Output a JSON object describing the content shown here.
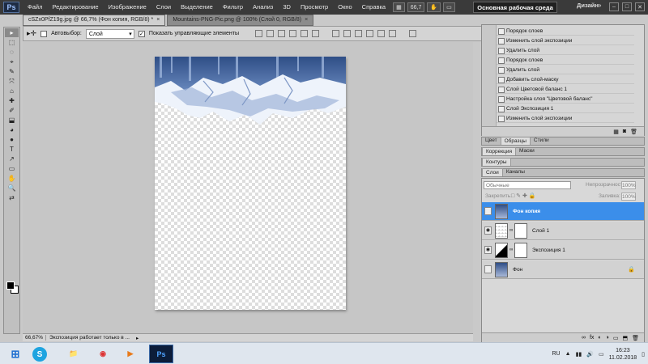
{
  "app": {
    "logo": "Ps"
  },
  "menu": [
    "Файл",
    "Редактирование",
    "Изображение",
    "Слои",
    "Выделение",
    "Фильтр",
    "Анализ",
    "3D",
    "Просмотр",
    "Окно",
    "Справка"
  ],
  "menu_controls": {
    "zoom": "66,7"
  },
  "workspace": {
    "active": "Основная рабочая среда",
    "design": "Дизайн",
    "more": "»"
  },
  "window_controls": [
    "–",
    "□",
    "✕"
  ],
  "doc_tabs": [
    {
      "label": "cSZx0PfZ19g.jpg @ 66,7% (Фон копия, RGB/8) *",
      "close": "×"
    },
    {
      "label": "Mountains-PNG-Pic.png @ 100% (Слой 0, RGB/8)",
      "close": "×"
    }
  ],
  "options": {
    "autoselect_label": "Автовыбор:",
    "autoselect_value": "Слой",
    "show_controls_label": "Показать управляющие элементы"
  },
  "tools": [
    "▸",
    "⬚",
    "◌",
    "⌖",
    "✎",
    "⤧",
    "⌂",
    "✚",
    "✐",
    "⬓",
    "◕",
    "●",
    "T",
    "↗",
    "▭",
    "✋",
    "🔍",
    "⇄"
  ],
  "status": {
    "zoom": "66,67%",
    "message": "Экспозиция работает только в ..."
  },
  "history": {
    "items": [
      "Порядок слоев",
      "Изменить слой экспозиции",
      "Удалить слой",
      "Порядок слоев",
      "Удалить слой",
      "Добавить слой-маску",
      "Слой Цветовой баланс 1",
      "Настройка слоя \"Цветовой баланс\"",
      "Слой Экспозиция 1",
      "Изменить слой экспозиции"
    ]
  },
  "panels": {
    "color_tabs": [
      "Цвет",
      "Образцы",
      "Стили"
    ],
    "correction_tabs": [
      "Коррекция",
      "Маски"
    ],
    "paths_tabs": [
      "Контуры"
    ],
    "layer_tabs": [
      "Слои",
      "Каналы"
    ]
  },
  "layers_panel": {
    "blend": "Обычные",
    "opacity_label": "Непрозрачность:",
    "opacity_value": "100%",
    "lock_label": "Закрепить:",
    "fill_label": "Заливка:",
    "fill_value": "100%",
    "layers": [
      {
        "name": "Фон копия",
        "selected": true
      },
      {
        "name": "Слой 1",
        "selected": false
      },
      {
        "name": "Экспозиция 1",
        "selected": false
      },
      {
        "name": "Фон",
        "selected": false
      }
    ],
    "footer_icons": [
      "∞",
      "fx",
      "◐",
      "◑",
      "▭",
      "⬒",
      "🗑"
    ]
  },
  "taskbar": {
    "apps": [
      "⊞",
      "S",
      "📁",
      "◉",
      "▶",
      "Ps"
    ],
    "lang": "RU",
    "time": "16:23",
    "date": "11.02.2018"
  }
}
